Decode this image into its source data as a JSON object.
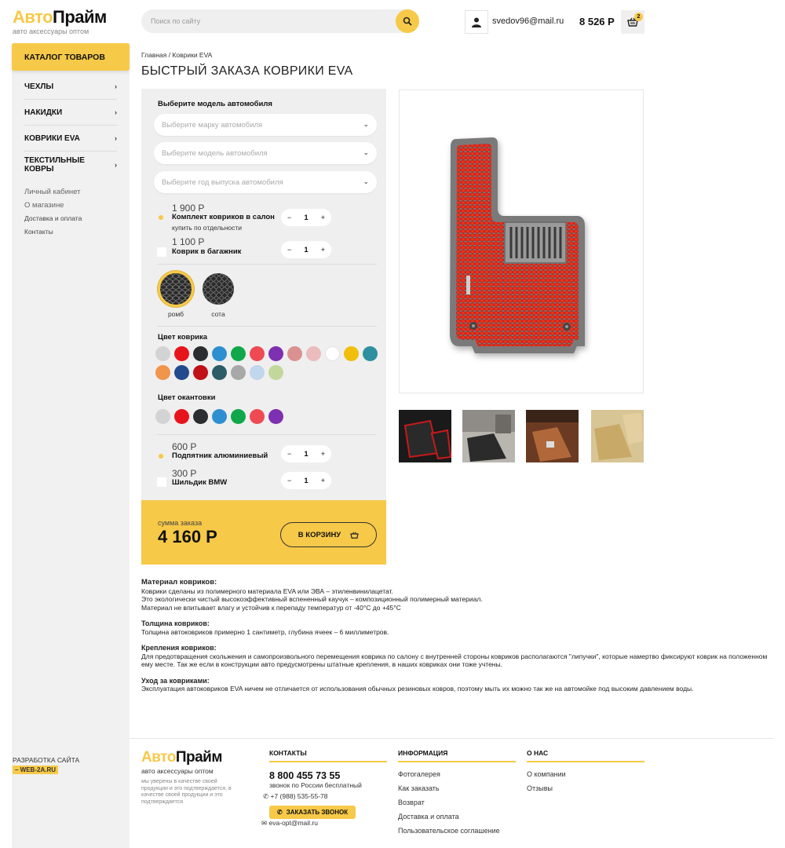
{
  "header": {
    "logo_part1": "Авто",
    "logo_part2": "Прайм",
    "logo_sub": "авто аксессуары оптом",
    "search_placeholder": "Поиск по сайту",
    "user_email": "svedov96@mail.ru",
    "balance": "8 526 Р",
    "cart_count": "2"
  },
  "sidebar": {
    "catalog_label": "КАТАЛОГ ТОВАРОВ",
    "categories": [
      {
        "label": "ЧЕХЛЫ"
      },
      {
        "label": "НАКИДКИ"
      },
      {
        "label": "КОВРИКИ EVA"
      },
      {
        "label": "ТЕКСТИЛЬНЫЕ КОВРЫ"
      }
    ],
    "links": [
      "Личный кабинет",
      "О магазине",
      "Доставка и оплата",
      "Контакты"
    ],
    "developer_label": "РАЗРАБОТКА САЙТА",
    "developer_badge": "– WEB-2A.RU"
  },
  "breadcrumb": "Главная / Коврики EVA",
  "page_title": "БЫСТРЫЙ ЗАКАЗА КОВРИКИ EVA",
  "config": {
    "model_heading": "Выберите модель автомобиля",
    "selects": [
      "Выберите марку автомобиля",
      "Выберите модель автомобиля",
      "Выберите год выпуска автомобиля"
    ],
    "options": [
      {
        "price": "1 900 Р",
        "name": "Комплект ковриков в салон",
        "note": "купить по отдельности",
        "qty": "1",
        "selected": true
      },
      {
        "price": "1 100 Р",
        "name": "Коврик в багажник",
        "note": "",
        "qty": "1",
        "selected": false
      }
    ],
    "patterns": [
      {
        "label": "ромб",
        "selected": true
      },
      {
        "label": "сота",
        "selected": false
      }
    ],
    "mat_color_heading": "Цвет коврика",
    "mat_colors": [
      "#d3d3d3",
      "#e8141c",
      "#2b2d30",
      "#2e8fd0",
      "#10a84a",
      "#ef4a54",
      "#7d30b0",
      "#d99290",
      "#ecbcbc",
      "#ffffff",
      "#f1be0b",
      "#2e8f9e",
      "#f0954b",
      "#234a8d",
      "#c11018",
      "#2c5c66",
      "#a8a8a8",
      "#c2d6ee",
      "#c2d89a"
    ],
    "edge_color_heading": "Цвет окантовки",
    "edge_colors": [
      "#d3d3d3",
      "#e8141c",
      "#2b2d30",
      "#2e8fd0",
      "#10a84a",
      "#ef4a54",
      "#7d30b0"
    ],
    "extras": [
      {
        "price": "600 Р",
        "name": "Подпятник алюминиевый",
        "qty": "1",
        "selected": true
      },
      {
        "price": "300 Р",
        "name": "Шильдик BMW",
        "qty": "1",
        "selected": false
      }
    ],
    "total_label": "сумма заказа",
    "total_value": "4 160 Р",
    "cart_button": "В КОРЗИНУ"
  },
  "description": [
    {
      "title": "Материал ковриков:",
      "lines": [
        "Коврики сделаны из полимерного материала EVA или ЭВА – этиленвинилацетат.",
        "Это экологически чистый высокоэффективный вспененный каучук – композиционный полимерный материал.",
        "Материал не впитывает влагу и устойчив к перепаду температур от -40°С до +45°С"
      ]
    },
    {
      "title": "Толщина ковриков:",
      "lines": [
        "Толщина автоковриков примерно 1 сантиметр, глубина ячеек – 6 миллиметров."
      ]
    },
    {
      "title": "Крепления ковриков:",
      "lines": [
        "Для предотвращения скольжения и самопроизвольного перемещения коврика по салону с внутренней стороны ковриков располагаются \"липучки\", которые намертво фиксируют коврик на положенном ему месте. Так же если в конструкции авто предусмотрены штатные крепления, в наших ковриках они тоже учтены."
      ]
    },
    {
      "title": "Уход за ковриками:",
      "lines": [
        "Эксплуатация автоковриков EVA ничем не отличается от использования обычных резиновых ковров, поэтому мыть их можно так же на автомойке под высоким давлением воды."
      ]
    }
  ],
  "footer": {
    "logo_sub": "авто аксессуары оптом",
    "note": "мы уверены в качестве своей продукции и это подтверждается, в качестве своей продукции и это подтверждается",
    "contacts_heading": "КОНТАКТЫ",
    "phone": "8 800 455 73 55",
    "phone_note": "звонок по России бесплатный",
    "phone2": "+7 (988) 535-55-78",
    "call_button": "ЗАКАЗАТЬ ЗВОНОК",
    "email": "eva-opt@mail.ru",
    "info_heading": "ИНФОРМАЦИЯ",
    "info_links": [
      "Фотогалерея",
      "Как заказать",
      "Возврат",
      "Доставка и оплата",
      "Пользовательское соглашение"
    ],
    "about_heading": "О НАС",
    "about_links": [
      "О компании",
      "Отзывы"
    ]
  },
  "colors": {
    "accent": "#f7c948",
    "panel": "#efefef",
    "mat_red": "#e0281c",
    "mat_border": "#7a7a7a"
  }
}
